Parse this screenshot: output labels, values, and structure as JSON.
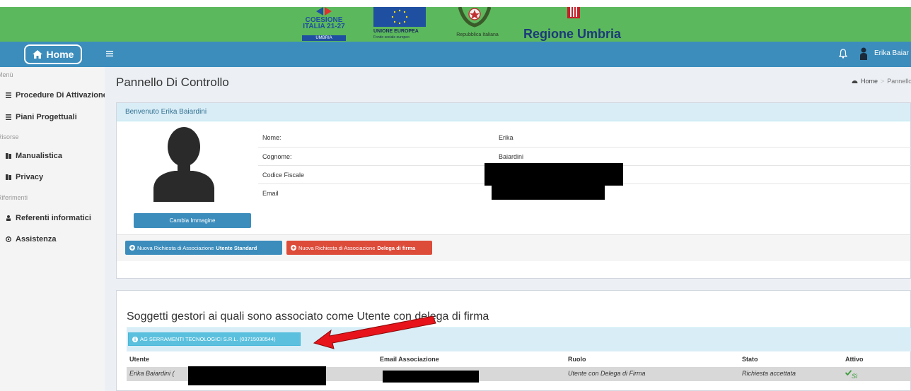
{
  "banner": {
    "coesione_line1": "COESIONE",
    "coesione_line2": "ITALIA 21-27",
    "coesione_sub": "UMBRIA",
    "eu_line1": "UNIONE EUROPEA",
    "eu_line2": "Fondo sociale europeo",
    "repubblica": "Repubblica Italiana",
    "regione": "Regione Umbria"
  },
  "navbar": {
    "home_label": "Home",
    "user_name": "Erika Baiar"
  },
  "sidebar": {
    "headers": [
      "Menù",
      "Risorse",
      "Riferimenti"
    ],
    "items": [
      {
        "label": "Procedure Di Attivazione",
        "icon": "list-icon"
      },
      {
        "label": "Piani Progettuali",
        "icon": "list-icon"
      },
      {
        "label": "Manualistica",
        "icon": "book-icon"
      },
      {
        "label": "Privacy",
        "icon": "book-icon"
      },
      {
        "label": "Referenti informatici",
        "icon": "user-icon"
      },
      {
        "label": "Assistenza",
        "icon": "lifebuoy-icon"
      }
    ]
  },
  "page": {
    "title": "Pannello Di Controllo",
    "breadcrumb": [
      "Home",
      "Pannello di Contr"
    ]
  },
  "profile": {
    "welcome": "Benvenuto Erika Baiardini",
    "change_image": "Cambia Immagine",
    "fields": [
      {
        "label": "Nome:",
        "value": "Erika"
      },
      {
        "label": "Cognome:",
        "value": "Baiardini"
      },
      {
        "label": "Codice Fiscale",
        "value": ""
      },
      {
        "label": "Email",
        "value": ""
      }
    ],
    "btn_standard_prefix": "Nuova Richiesta di Associazione",
    "btn_standard_bold": "Utente Standard",
    "btn_delega_prefix": "Nuova Richiesta di Associazione",
    "btn_delega_bold": "Delega di firma"
  },
  "soggetti": {
    "title": "Soggetti gestori ai quali sono associato come Utente con delega di firma",
    "company": "AG SERRAMENTI TECNOLOGICI S.R.L. (03715030544)",
    "columns": [
      "Utente",
      "Email Associazione",
      "Ruolo",
      "Stato",
      "Attivo"
    ],
    "rows": [
      {
        "utente": "Erika Baiardini (",
        "email": "",
        "ruolo": "Utente con Delega di Firma",
        "stato": "Richiesta accettata",
        "attivo": "Sì"
      }
    ]
  },
  "colors": {
    "banner_green": "#5cb85c",
    "navbar_blue": "#3c8dbc",
    "danger_red": "#dd4b39",
    "info_cyan": "#5bc0de",
    "arrow_red": "#e8141b"
  }
}
